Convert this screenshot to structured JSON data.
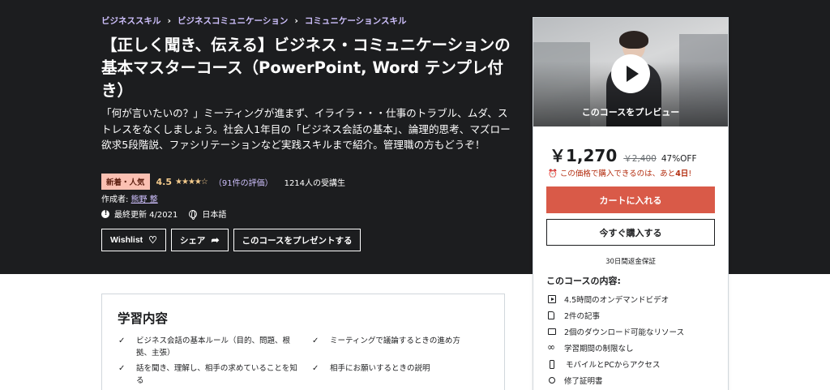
{
  "breadcrumb": {
    "items": [
      "ビジネススキル",
      "ビジネスコミュニケーション",
      "コミュニケーションスキル"
    ],
    "separator": "›"
  },
  "course": {
    "title": "【正しく聞き、伝える】ビジネス・コミュニケーションの基本マスターコース（PowerPoint, Word テンプレ付き）",
    "subtitle": "「何が言いたいの？」ミーティングが進まず、イライラ・・・仕事のトラブル、ムダ、ストレスをなくしましょう。社会人1年目の「ビジネス会話の基本」、論理的思考、マズロー欲求5段階説、ファシリテーションなど実践スキルまで紹介。管理職の方もどうぞ！",
    "badge": "新着・人気",
    "rating": "4.5",
    "stars": "★★★★☆",
    "reviews": "（91件の評価）",
    "students": "1214人の受講生",
    "author_label": "作成者:",
    "author_name": "熊野 整",
    "last_updated": "最終更新 4/2021",
    "language": "日本語",
    "buttons": {
      "wishlist": "Wishlist",
      "share": "シェア",
      "gift": "このコースをプレゼントする"
    }
  },
  "sidebar": {
    "preview_label": "このコースをプレビュー",
    "price": "￥1,270",
    "old_price": "￥2,400",
    "discount": "47%OFF",
    "timer_prefix": "この価格で購入できるのは、あと",
    "timer_value": "4日",
    "timer_suffix": "!",
    "add_to_cart": "カートに入れる",
    "buy_now": "今すぐ購入する",
    "guarantee": "30日間返金保証",
    "includes_title": "このコースの内容:",
    "includes": [
      {
        "icon": "video-icon",
        "text": "4.5時間のオンデマンドビデオ"
      },
      {
        "icon": "file-icon",
        "text": "2件の記事"
      },
      {
        "icon": "download-folder-icon",
        "text": "2個のダウンロード可能なリソース"
      },
      {
        "icon": "infinity-icon",
        "text": "学習期間の制限なし"
      },
      {
        "icon": "mobile-icon",
        "text": "モバイルとPCからアクセス"
      },
      {
        "icon": "trophy-icon",
        "text": "修了証明書"
      }
    ]
  },
  "learn": {
    "title": "学習内容",
    "items": [
      "ビジネス会話の基本ルール（目的、問題、根拠、主張）",
      "ミーティングで議論するときの進め方",
      "話を聞き、理解し、相手の求めていることを知る",
      "相手にお願いするときの説明"
    ]
  },
  "colors": {
    "hero_bg": "#1c1d1f",
    "link_purple": "#cec0fc",
    "star_gold": "#f3ca8c",
    "cart_red": "#d95a48",
    "timer_red": "#b32d0f"
  }
}
